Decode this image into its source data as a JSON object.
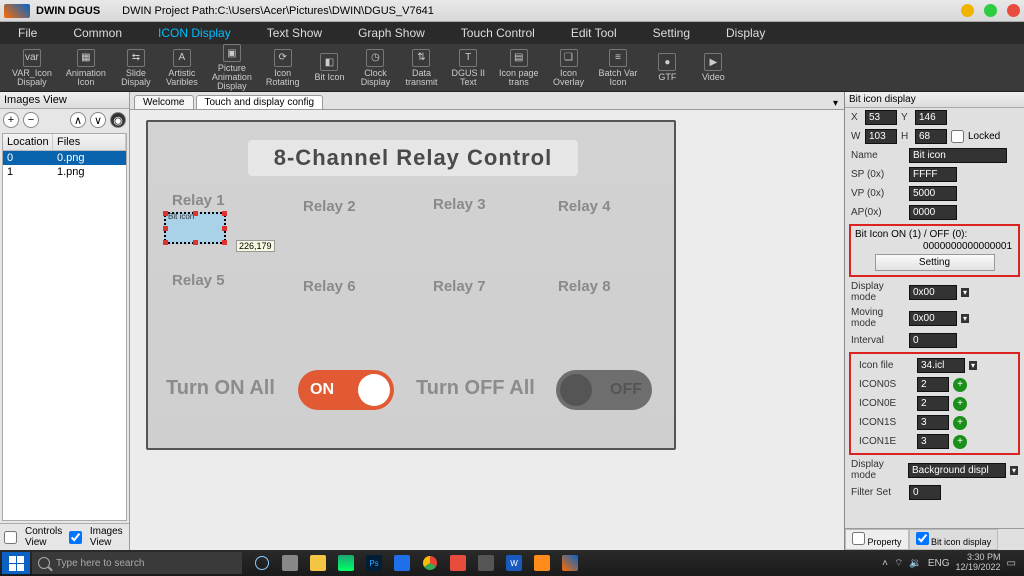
{
  "titlebar": {
    "app": "DWIN DGUS",
    "path": "DWIN Project Path:C:\\Users\\Acer\\Pictures\\DWIN\\DGUS_V7641"
  },
  "menu": [
    "File",
    "Common",
    "ICON Display",
    "Text Show",
    "Graph Show",
    "Touch Control",
    "Edit Tool",
    "Setting",
    "Display"
  ],
  "menu_active": 2,
  "tools": [
    {
      "l": "VAR_Icon\nDispaly",
      "i": "var"
    },
    {
      "l": "Animation\nIcon",
      "i": "▦"
    },
    {
      "l": "Slide\nDispaly",
      "i": "⇆"
    },
    {
      "l": "Artistic\nVaribles",
      "i": "A"
    },
    {
      "l": "Picture\nAnimation\nDisplay",
      "i": "▣"
    },
    {
      "l": "Icon\nRotating",
      "i": "⟳"
    },
    {
      "l": "Bit Icon",
      "i": "◧"
    },
    {
      "l": "Clock\nDisplay",
      "i": "◷"
    },
    {
      "l": "Data\ntransmit",
      "i": "⇅"
    },
    {
      "l": "DGUS II\nText",
      "i": "T"
    },
    {
      "l": "Icon page\ntrans",
      "i": "▤"
    },
    {
      "l": "Icon\nOverlay",
      "i": "❏"
    },
    {
      "l": "Batch Var\nIcon",
      "i": "≡"
    },
    {
      "l": "GTF",
      "i": "●"
    },
    {
      "l": "Video",
      "i": "▶"
    }
  ],
  "left": {
    "title": "Images View",
    "cols": {
      "loc": "Location",
      "file": "Files"
    },
    "rows": [
      {
        "loc": "0",
        "file": "0.png",
        "sel": true
      },
      {
        "loc": "1",
        "file": "1.png",
        "sel": false
      }
    ],
    "bottom": {
      "ctrl": "Controls View",
      "img": "Images View"
    }
  },
  "tabs": [
    {
      "t": "Welcome"
    },
    {
      "t": "Touch and display config"
    }
  ],
  "tabs_active": 1,
  "canvas": {
    "title": "8-Channel Relay Control",
    "relays": [
      "Relay 1",
      "Relay 2",
      "Relay 3",
      "Relay 4",
      "Relay 5",
      "Relay 6",
      "Relay 7",
      "Relay 8"
    ],
    "coord": "226,179",
    "onall": "Turn ON All",
    "on": "ON",
    "offall": "Turn OFF All",
    "off": "OFF",
    "sel_label": "Bit icon"
  },
  "right": {
    "title": "Bit icon display",
    "X": "53",
    "Y": "146",
    "W": "103",
    "H": "68",
    "locked": "Locked",
    "name_l": "Name",
    "name": "Bit icon",
    "sp_l": "SP (0x)",
    "sp": "FFFF",
    "vp_l": "VP (0x)",
    "vp": "5000",
    "ap_l": "AP(0x)",
    "ap": "0000",
    "biton_l": "Bit Icon ON (1) / OFF (0):",
    "biton": "0000000000000001",
    "setting": "Setting",
    "disp_l": "Display mode",
    "disp": "0x00",
    "move_l": "Moving mode",
    "move": "0x00",
    "int_l": "Interval",
    "int": "0",
    "icl_l": "Icon file",
    "icl": "34.icl",
    "i0s_l": "ICON0S",
    "i0s": "2",
    "i0e_l": "ICON0E",
    "i0e": "2",
    "i1s_l": "ICON1S",
    "i1s": "3",
    "i1e_l": "ICON1E",
    "i1e": "3",
    "disp2_l": "Display mode",
    "disp2": "Background displ",
    "filt_l": "Filter Set",
    "filt": "0",
    "t1": "Property",
    "t2": "Bit icon display"
  },
  "taskbar": {
    "search": "Type here to search",
    "lang": "ENG",
    "time": "3:30 PM",
    "date": "12/19/2022"
  }
}
